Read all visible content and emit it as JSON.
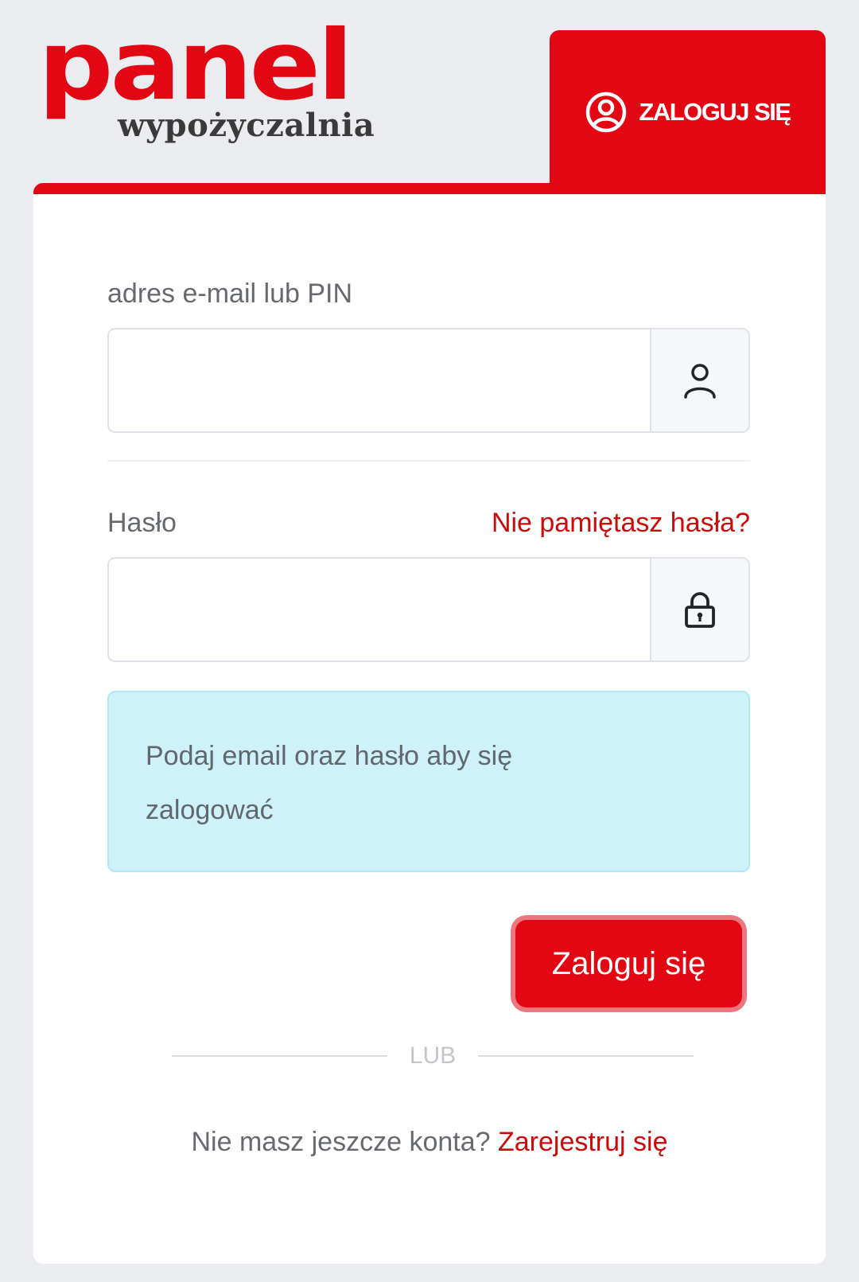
{
  "brand": {
    "logo_main": "panel",
    "logo_sub": "wypożyczalnia",
    "accent_color": "#e30613"
  },
  "header": {
    "login_tab_label": "ZALOGUJ SIĘ",
    "login_tab_icon": "user-circle-icon"
  },
  "form": {
    "email_label": "adres e-mail lub PIN",
    "email_value": "",
    "email_icon": "user-icon",
    "password_label": "Hasło",
    "password_value": "",
    "password_icon": "lock-icon",
    "forgot_link": "Nie pamiętasz hasła?",
    "info_message": "Podaj email oraz hasło aby się zalogować",
    "submit_label": "Zaloguj się"
  },
  "footer": {
    "or_text": "LUB",
    "register_prompt": "Nie masz jeszcze konta?",
    "register_link": "Zarejestruj się"
  }
}
